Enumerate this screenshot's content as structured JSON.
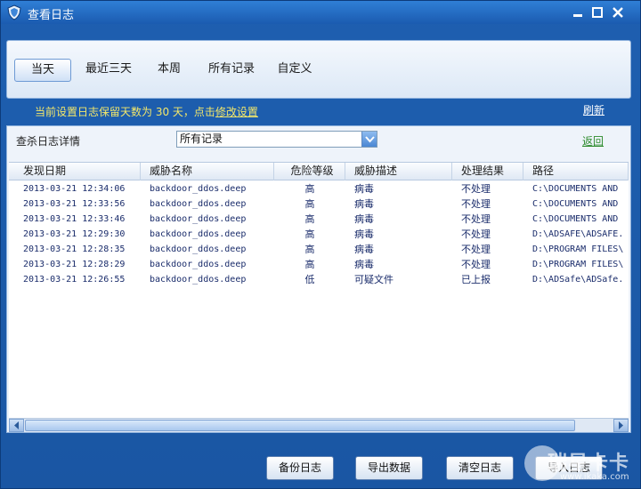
{
  "window": {
    "title": "查看日志"
  },
  "tabs": [
    {
      "label": "当天",
      "active": true
    },
    {
      "label": "最近三天",
      "active": false
    },
    {
      "label": "本周",
      "active": false
    },
    {
      "label": "所有记录",
      "active": false
    },
    {
      "label": "自定义",
      "active": false
    }
  ],
  "notice": {
    "text": "当前设置日志保留天数为 30 天，点击",
    "link": "修改设置"
  },
  "refresh_label": "刷新",
  "filter": {
    "label": "查杀日志详情",
    "selected": "所有记录"
  },
  "back_label": "返回",
  "table": {
    "headers": [
      "发现日期",
      "威胁名称",
      "危险等级",
      "威胁描述",
      "处理结果",
      "路径"
    ],
    "rows": [
      [
        "2013-03-21 12:34:06",
        "backdoor_ddos.deep",
        "高",
        "病毒",
        "不处理",
        "C:\\DOCUMENTS AND"
      ],
      [
        "2013-03-21 12:33:56",
        "backdoor_ddos.deep",
        "高",
        "病毒",
        "不处理",
        "C:\\DOCUMENTS AND"
      ],
      [
        "2013-03-21 12:33:46",
        "backdoor_ddos.deep",
        "高",
        "病毒",
        "不处理",
        "C:\\DOCUMENTS AND"
      ],
      [
        "2013-03-21 12:29:30",
        "backdoor_ddos.deep",
        "高",
        "病毒",
        "不处理",
        "D:\\ADSAFE\\ADSAFE."
      ],
      [
        "2013-03-21 12:28:35",
        "backdoor_ddos.deep",
        "高",
        "病毒",
        "不处理",
        "D:\\PROGRAM FILES\\"
      ],
      [
        "2013-03-21 12:28:29",
        "backdoor_ddos.deep",
        "高",
        "病毒",
        "不处理",
        "D:\\PROGRAM FILES\\"
      ],
      [
        "2013-03-21 12:26:55",
        "backdoor_ddos.deep",
        "低",
        "可疑文件",
        "已上报",
        "D:\\ADSafe\\ADSafe."
      ]
    ]
  },
  "buttons": {
    "backup": "备份日志",
    "export": "导出数据",
    "clear": "清空日志",
    "import": "导入日志"
  },
  "watermark": {
    "text": "瑞星卡卡",
    "url": "www.ikaka.com"
  },
  "colors": {
    "window_bg": "#1e5fb0",
    "notice_text": "#f3e76a",
    "back_link": "#2b8a2b",
    "row_text": "#1a2c6b"
  },
  "icons": {
    "app": "shield-icon",
    "dropdown": "chevron-down-icon",
    "scroll_left": "arrow-left-icon",
    "scroll_right": "arrow-right-icon"
  }
}
